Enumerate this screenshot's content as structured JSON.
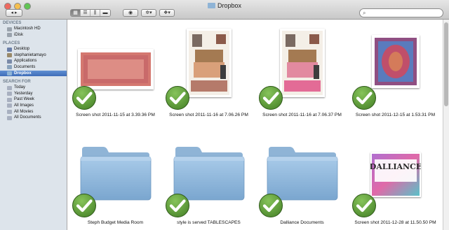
{
  "window": {
    "title": "Dropbox"
  },
  "toolbar": {
    "view_icon_glyph": "◫",
    "eye_glyph": "◉",
    "gear_glyph": "✲",
    "dropbox_glyph": "❖",
    "search_placeholder": ""
  },
  "sidebar": {
    "sections": [
      {
        "title": "DEVICES",
        "items": [
          {
            "label": "Macintosh HD",
            "icon": "hard-drive-icon",
            "color": "#9aa3ad"
          },
          {
            "label": "iDisk",
            "icon": "idisk-icon",
            "color": "#9aa3ad"
          }
        ]
      },
      {
        "title": "PLACES",
        "items": [
          {
            "label": "Desktop",
            "icon": "desktop-icon",
            "color": "#6b7fa8"
          },
          {
            "label": "stephanietamayo",
            "icon": "home-icon",
            "color": "#9a8a6a"
          },
          {
            "label": "Applications",
            "icon": "applications-icon",
            "color": "#7a8aa8"
          },
          {
            "label": "Documents",
            "icon": "documents-icon",
            "color": "#8aa3bd"
          },
          {
            "label": "Dropbox",
            "icon": "dropbox-icon",
            "color": "#8fb4d6",
            "selected": true
          }
        ]
      },
      {
        "title": "SEARCH FOR",
        "items": [
          {
            "label": "Today",
            "icon": "clock-icon",
            "color": "#a8b0c0"
          },
          {
            "label": "Yesterday",
            "icon": "clock-icon",
            "color": "#a8b0c0"
          },
          {
            "label": "Past Week",
            "icon": "clock-icon",
            "color": "#a8b0c0"
          },
          {
            "label": "All Images",
            "icon": "smart-folder-icon",
            "color": "#a8b0c0"
          },
          {
            "label": "All Movies",
            "icon": "smart-folder-icon",
            "color": "#a8b0c0"
          },
          {
            "label": "All Documents",
            "icon": "smart-folder-icon",
            "color": "#a8b0c0"
          }
        ]
      }
    ]
  },
  "files": [
    {
      "name": "Screen shot 2011-11-15 at 3.39.36 PM",
      "kind": "rug-pink"
    },
    {
      "name": "Screen shot 2011-11-16 at 7.06.26 PM",
      "kind": "moodboard"
    },
    {
      "name": "Screen shot 2011-11-16 at 7.06.37 PM",
      "kind": "moodboard-pink"
    },
    {
      "name": "Screen shot 2011-12-15 at 1.53.31 PM",
      "kind": "rug-purple"
    },
    {
      "name": "Steph Budget Media Room",
      "kind": "folder"
    },
    {
      "name": "style is served TABLESCAPES",
      "kind": "folder"
    },
    {
      "name": "Dalliance Documents",
      "kind": "folder"
    },
    {
      "name": "Screen shot 2011-12-28 at 11.50.50 PM",
      "kind": "dalliance",
      "logo_text": "DALLIANCE"
    }
  ],
  "colors": {
    "check_green": "#4e8a2e",
    "folder_blue": "#8fb6da",
    "selection": "#3f6db8"
  }
}
